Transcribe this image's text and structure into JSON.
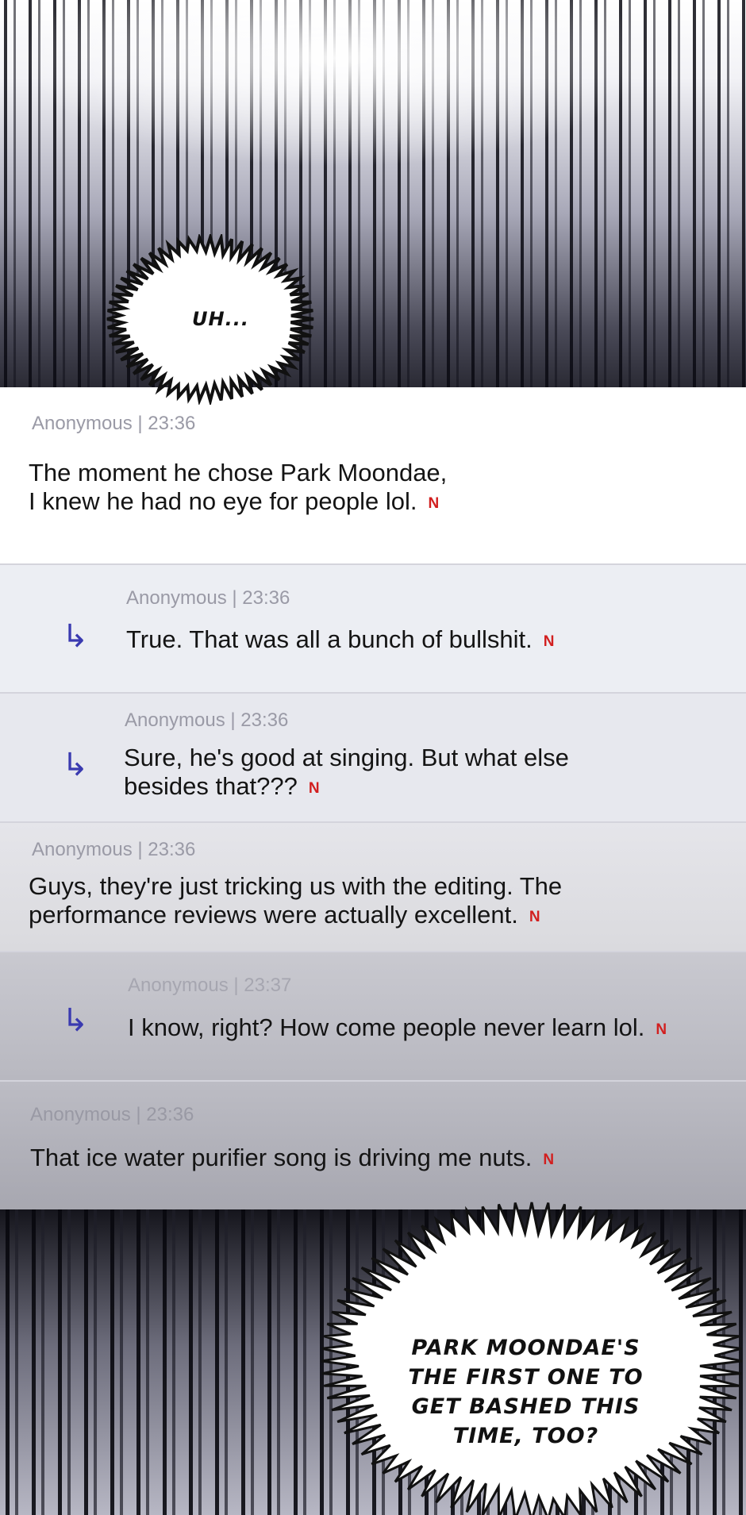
{
  "colors": {
    "accent_arrow": "#3a3ab0",
    "badge_red": "#d21f1f",
    "meta_gray": "#9a9aa6"
  },
  "top_panel": {
    "speech": "UH..."
  },
  "comments": [
    {
      "meta": "Anonymous | 23:36",
      "text": "The moment he chose Park Moondae,\nI knew he had no eye for people lol.",
      "badge": "N",
      "is_reply": false
    },
    {
      "meta": "Anonymous | 23:36",
      "text": "True. That was all a bunch of bullshit.",
      "badge": "N",
      "is_reply": true,
      "arrow_icon": "reply-arrow-icon"
    },
    {
      "meta": "Anonymous | 23:36",
      "text": "Sure, he's good at singing. But what else\nbesides that???",
      "badge": "N",
      "is_reply": true,
      "arrow_icon": "reply-arrow-icon"
    },
    {
      "meta": "Anonymous | 23:36",
      "text": "Guys, they're just tricking us with the editing. The\nperformance reviews were actually excellent.",
      "badge": "N",
      "is_reply": false
    },
    {
      "meta": "Anonymous | 23:37",
      "text": "I know, right? How come people never learn lol.",
      "badge": "N",
      "is_reply": true,
      "arrow_icon": "reply-arrow-icon"
    },
    {
      "meta": "Anonymous | 23:36",
      "text": "That ice water purifier song is driving me nuts.",
      "badge": "N",
      "is_reply": false
    }
  ],
  "bottom_panel": {
    "speech": "PARK MOONDAE'S\nTHE FIRST ONE TO\nGET BASHED THIS\nTIME, TOO?"
  }
}
